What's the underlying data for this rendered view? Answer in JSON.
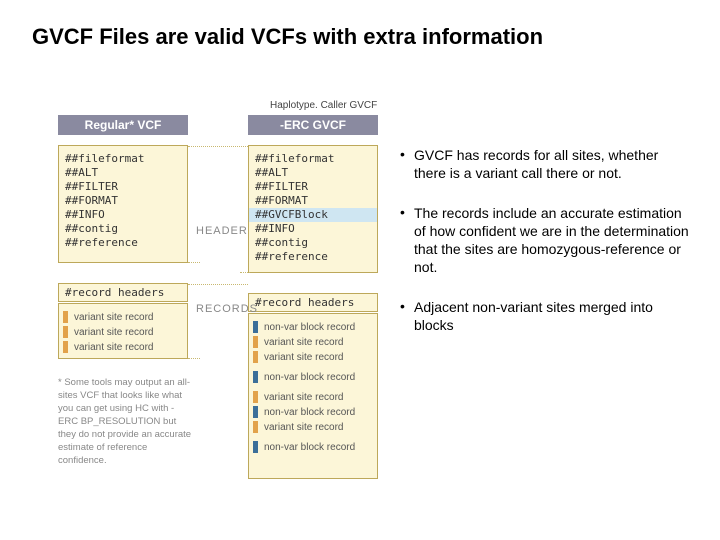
{
  "title": "GVCF Files are valid VCFs with extra information",
  "left_tab_label": "Regular* VCF",
  "right_tab_subtext": "Haplotype. Caller GVCF",
  "right_tab_label": "-ERC GVCF",
  "regular_header_lines": [
    "##fileformat",
    "##ALT",
    "##FILTER",
    "##FORMAT",
    "##INFO",
    "##contig",
    "##reference"
  ],
  "erc_header_lines_before": [
    "##fileformat",
    "##ALT",
    "##FILTER",
    "##FORMAT"
  ],
  "erc_header_highlight": "##GVCFBlock",
  "erc_header_lines_after": [
    "##INFO",
    "##contig",
    "##reference"
  ],
  "record_headers_label": "#record headers",
  "regular_records": [
    "variant site record",
    "variant site record",
    "variant site record"
  ],
  "erc_records": [
    {
      "t": "blue",
      "l": "non-var block record"
    },
    {
      "t": "orange",
      "l": "variant site record"
    },
    {
      "t": "orange",
      "l": "variant site record"
    },
    {
      "t": "blue",
      "l": "non-var block record"
    },
    {
      "t": "orange",
      "l": "variant site record"
    },
    {
      "t": "blue",
      "l": "non-var block record"
    },
    {
      "t": "orange",
      "l": "variant site record"
    },
    {
      "t": "blue",
      "l": "non-var block record"
    }
  ],
  "bridge_header": "HEADER",
  "bridge_records": "RECORDS",
  "footnote": "* Some tools may output an all-sites VCF that looks like what you can get using HC with -ERC BP_RESOLUTION but they do not provide an accurate estimate of reference confidence.",
  "bullets": [
    "GVCF has records for all sites, whether there is a variant call there or not.",
    "The records include an accurate estimation of how confident we are in the determination that the sites are homozygous-reference or not.",
    "Adjacent non-variant sites merged into blocks"
  ],
  "bullet_char": "•"
}
